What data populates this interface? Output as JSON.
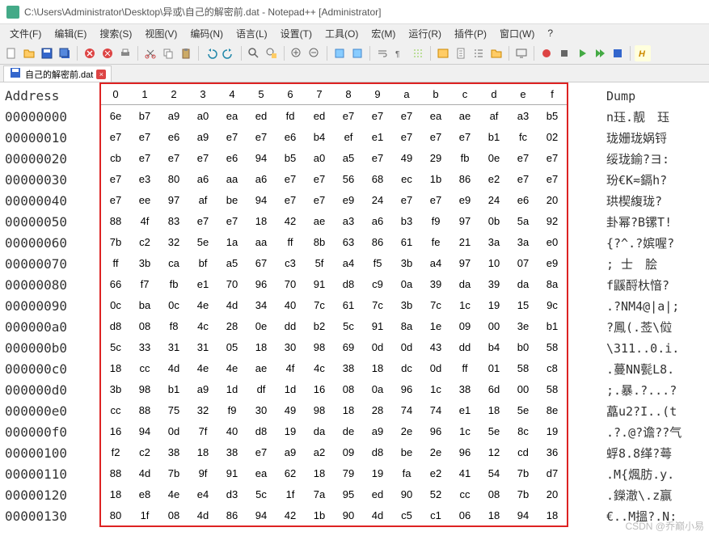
{
  "title": "C:\\Users\\Administrator\\Desktop\\异或\\自己的解密前.dat - Notepad++ [Administrator]",
  "menus": [
    "文件(F)",
    "编辑(E)",
    "搜索(S)",
    "视图(V)",
    "编码(N)",
    "语言(L)",
    "设置(T)",
    "工具(O)",
    "宏(M)",
    "运行(R)",
    "插件(P)",
    "窗口(W)",
    "?"
  ],
  "tab": {
    "label": "自己的解密前.dat",
    "close": "×"
  },
  "header": {
    "address": "Address",
    "cols": [
      "0",
      "1",
      "2",
      "3",
      "4",
      "5",
      "6",
      "7",
      "8",
      "9",
      "a",
      "b",
      "c",
      "d",
      "e",
      "f"
    ],
    "dump": "Dump"
  },
  "rows": [
    {
      "addr": "00000000",
      "hex": [
        "6e",
        "b7",
        "a9",
        "a0",
        "ea",
        "ed",
        "fd",
        "ed",
        "e7",
        "e7",
        "e7",
        "ea",
        "ae",
        "af",
        "a3",
        "b5"
      ],
      "dump": "n珏.靓　珏"
    },
    {
      "addr": "00000010",
      "hex": [
        "e7",
        "e7",
        "e6",
        "a9",
        "e7",
        "e7",
        "e6",
        "b4",
        "ef",
        "e1",
        "e7",
        "e7",
        "e7",
        "b1",
        "fc",
        "02"
      ],
      "dump": "珑姗珑娲锊"
    },
    {
      "addr": "00000020",
      "hex": [
        "cb",
        "e7",
        "e7",
        "e7",
        "e6",
        "94",
        "b5",
        "a0",
        "a5",
        "e7",
        "49",
        "29",
        "fb",
        "0e",
        "e7",
        "e7"
      ],
      "dump": "绥珑鍮?ヨ:"
    },
    {
      "addr": "00000030",
      "hex": [
        "e7",
        "e3",
        "80",
        "a6",
        "aa",
        "a6",
        "e7",
        "e7",
        "56",
        "68",
        "ec",
        "1b",
        "86",
        "e2",
        "e7",
        "e7"
      ],
      "dump": "玢€K≂鎘h?"
    },
    {
      "addr": "00000040",
      "hex": [
        "e7",
        "ee",
        "97",
        "af",
        "be",
        "94",
        "e7",
        "e7",
        "e9",
        "24",
        "e7",
        "e7",
        "e9",
        "24",
        "e6",
        "20"
      ],
      "dump": "珙楔緮珑?"
    },
    {
      "addr": "00000050",
      "hex": [
        "88",
        "4f",
        "83",
        "e7",
        "e7",
        "18",
        "42",
        "ae",
        "a3",
        "a6",
        "b3",
        "f9",
        "97",
        "0b",
        "5a",
        "92"
      ],
      "dump": "卦幂?B镙T!"
    },
    {
      "addr": "00000060",
      "hex": [
        "7b",
        "c2",
        "32",
        "5e",
        "1a",
        "aa",
        "ff",
        "8b",
        "63",
        "86",
        "61",
        "fe",
        "21",
        "3a",
        "3a",
        "e0"
      ],
      "dump": "{?^.?嫔喔?"
    },
    {
      "addr": "00000070",
      "hex": [
        "ff",
        "3b",
        "ca",
        "bf",
        "a5",
        "67",
        "c3",
        "5f",
        "a4",
        "f5",
        "3b",
        "a4",
        "97",
        "10",
        "07",
        "e9"
      ],
      "dump": " ; 士　脍"
    },
    {
      "addr": "00000080",
      "hex": [
        "66",
        "f7",
        "fb",
        "e1",
        "70",
        "96",
        "70",
        "91",
        "d8",
        "c9",
        "0a",
        "39",
        "da",
        "39",
        "da",
        "8a"
      ],
      "dump": "f鼷酹杕愔?"
    },
    {
      "addr": "00000090",
      "hex": [
        "0c",
        "ba",
        "0c",
        "4e",
        "4d",
        "34",
        "40",
        "7c",
        "61",
        "7c",
        "3b",
        "7c",
        "1c",
        "19",
        "15",
        "9c"
      ],
      "dump": ".?NM4@|a|;"
    },
    {
      "addr": "000000a0",
      "hex": [
        "d8",
        "08",
        "f8",
        "4c",
        "28",
        "0e",
        "dd",
        "b2",
        "5c",
        "91",
        "8a",
        "1e",
        "09",
        "00",
        "3e",
        "b1"
      ],
      "dump": "?鳳(.莶\\傡"
    },
    {
      "addr": "000000b0",
      "hex": [
        "5c",
        "33",
        "31",
        "31",
        "05",
        "18",
        "30",
        "98",
        "69",
        "0d",
        "0d",
        "43",
        "dd",
        "b4",
        "b0",
        "58"
      ],
      "dump": "\\311..0.i."
    },
    {
      "addr": "000000c0",
      "hex": [
        "18",
        "cc",
        "4d",
        "4e",
        "4e",
        "ae",
        "4f",
        "4c",
        "38",
        "18",
        "dc",
        "0d",
        "ff",
        "01",
        "58",
        "c8"
      ],
      "dump": ".蔓NN甏L8."
    },
    {
      "addr": "000000d0",
      "hex": [
        "3b",
        "98",
        "b1",
        "a9",
        "1d",
        "df",
        "1d",
        "16",
        "08",
        "0a",
        "96",
        "1c",
        "38",
        "6d",
        "00",
        "58"
      ],
      "dump": ";.暴.?...?"
    },
    {
      "addr": "000000e0",
      "hex": [
        "cc",
        "88",
        "75",
        "32",
        "f9",
        "30",
        "49",
        "98",
        "18",
        "28",
        "74",
        "74",
        "e1",
        "18",
        "5e",
        "8e"
      ],
      "dump": "藠u2?I..(t"
    },
    {
      "addr": "000000f0",
      "hex": [
        "16",
        "94",
        "0d",
        "7f",
        "40",
        "d8",
        "19",
        "da",
        "de",
        "a9",
        "2e",
        "96",
        "1c",
        "5e",
        "8c",
        "19"
      ],
      "dump": ".?.@?谵??气"
    },
    {
      "addr": "00000100",
      "hex": [
        "f2",
        "c2",
        "38",
        "18",
        "38",
        "e7",
        "a9",
        "a2",
        "09",
        "d8",
        "be",
        "2e",
        "96",
        "12",
        "cd",
        "36"
      ],
      "dump": "蜉8.8缂?蕚"
    },
    {
      "addr": "00000110",
      "hex": [
        "88",
        "4d",
        "7b",
        "9f",
        "91",
        "ea",
        "62",
        "18",
        "79",
        "19",
        "fa",
        "e2",
        "41",
        "54",
        "7b",
        "d7"
      ],
      "dump": ".M{煈肪.y."
    },
    {
      "addr": "00000120",
      "hex": [
        "18",
        "e8",
        "4e",
        "e4",
        "d3",
        "5c",
        "1f",
        "7a",
        "95",
        "ed",
        "90",
        "52",
        "cc",
        "08",
        "7b",
        "20"
      ],
      "dump": ".鑅澈\\.z赢"
    },
    {
      "addr": "00000130",
      "hex": [
        "80",
        "1f",
        "08",
        "4d",
        "86",
        "94",
        "42",
        "1b",
        "90",
        "4d",
        "c5",
        "c1",
        "06",
        "18",
        "94",
        "18"
      ],
      "dump": "€..M搵?.N:"
    }
  ],
  "watermark": "CSDN @乔巅小易"
}
